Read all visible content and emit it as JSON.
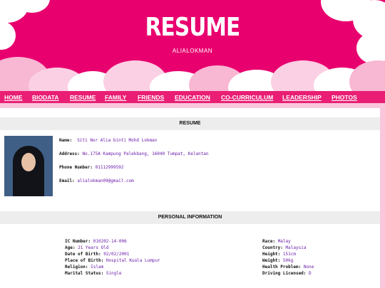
{
  "header": {
    "title": "RESUME",
    "subtitle": "ALIALOKMAN"
  },
  "nav": {
    "items": [
      "HOME",
      "BIODATA",
      "RESUME",
      "FAMILY",
      "FRIENDS",
      "EDUCATION",
      "CO-CURRICULUM",
      "LEADERSHIP",
      "PHOTOS"
    ]
  },
  "resume": {
    "heading": "RESUME",
    "name_label": "Name:",
    "name_value": "Siti Nor Alia binti Mohd Lokman",
    "address_label": "Address:",
    "address_value": "No.175A Kampung Palekbang, 16040 Tumpat, Kelantan",
    "phone_label": "Phone Number:",
    "phone_value": "01112999592",
    "email_label": "Email:",
    "email_value": "alialokman09@gmail.com"
  },
  "personal": {
    "heading": "PERSONAL INFORMATION",
    "left": [
      {
        "label": "IC Number:",
        "value": "010202-14-006"
      },
      {
        "label": "Age:",
        "value": "21 Years Old"
      },
      {
        "label": "Date of Birth:",
        "value": "02/02/2001"
      },
      {
        "label": "Place of Birth:",
        "value": "Hospital Kuala Lumpur"
      },
      {
        "label": "Religion:",
        "value": "Islam"
      },
      {
        "label": "Marital Status:",
        "value": "Single"
      }
    ],
    "right": [
      {
        "label": "Race:",
        "value": "Malay"
      },
      {
        "label": "Country:",
        "value": "Malaysia"
      },
      {
        "label": "Height:",
        "value": "151cm"
      },
      {
        "label": "Weight:",
        "value": "50kg"
      },
      {
        "label": "Health Problem:",
        "value": "None"
      },
      {
        "label": "Driving Licensed:",
        "value": "D"
      }
    ]
  },
  "colors": {
    "header_bg": "#e8006f",
    "nav_bg": "#e91e74",
    "value_text": "#6a1ba8",
    "frame_bg": "#f9c6dc"
  }
}
